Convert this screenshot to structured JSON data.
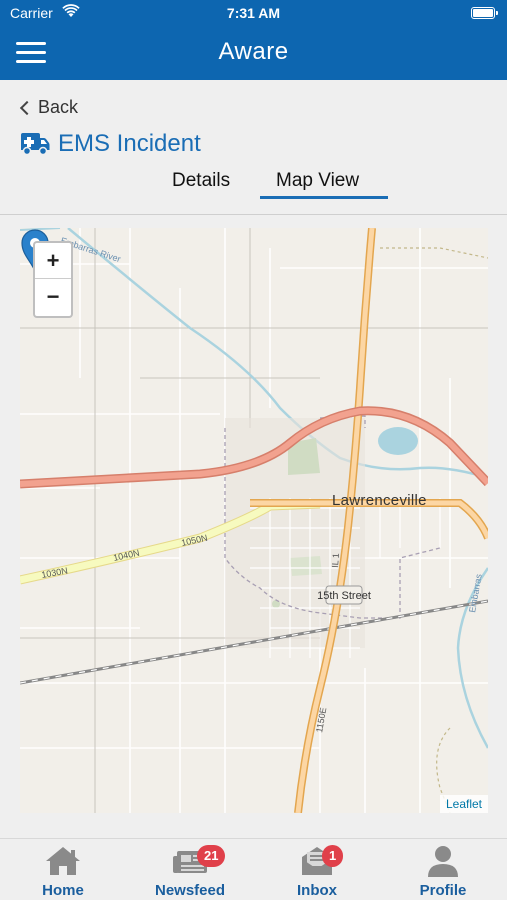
{
  "status": {
    "carrier": "Carrier",
    "time": "7:31 AM"
  },
  "header": {
    "title": "Aware"
  },
  "nav": {
    "back_label": "Back"
  },
  "incident": {
    "title": "EMS Incident"
  },
  "tabs": [
    {
      "label": "Details"
    },
    {
      "label": "Map View",
      "active": true
    }
  ],
  "map": {
    "town_label": "Lawrenceville",
    "zoom_in": "+",
    "zoom_out": "−",
    "attribution": "Leaflet",
    "road_labels": [
      "Embarras River",
      "1030N",
      "1040N",
      "1050N",
      "15th Street",
      "IL 1",
      "1150E",
      "Embarras"
    ]
  },
  "bottom_nav": [
    {
      "label": "Home",
      "icon": "home-icon"
    },
    {
      "label": "Newsfeed",
      "icon": "newspaper-icon",
      "badge": "21"
    },
    {
      "label": "Inbox",
      "icon": "inbox-icon",
      "badge": "1"
    },
    {
      "label": "Profile",
      "icon": "person-icon"
    }
  ],
  "colors": {
    "brand": "#0d66b0",
    "accent": "#1a6db5",
    "badge": "#e0404a",
    "nav_label": "#1a5e9e"
  }
}
